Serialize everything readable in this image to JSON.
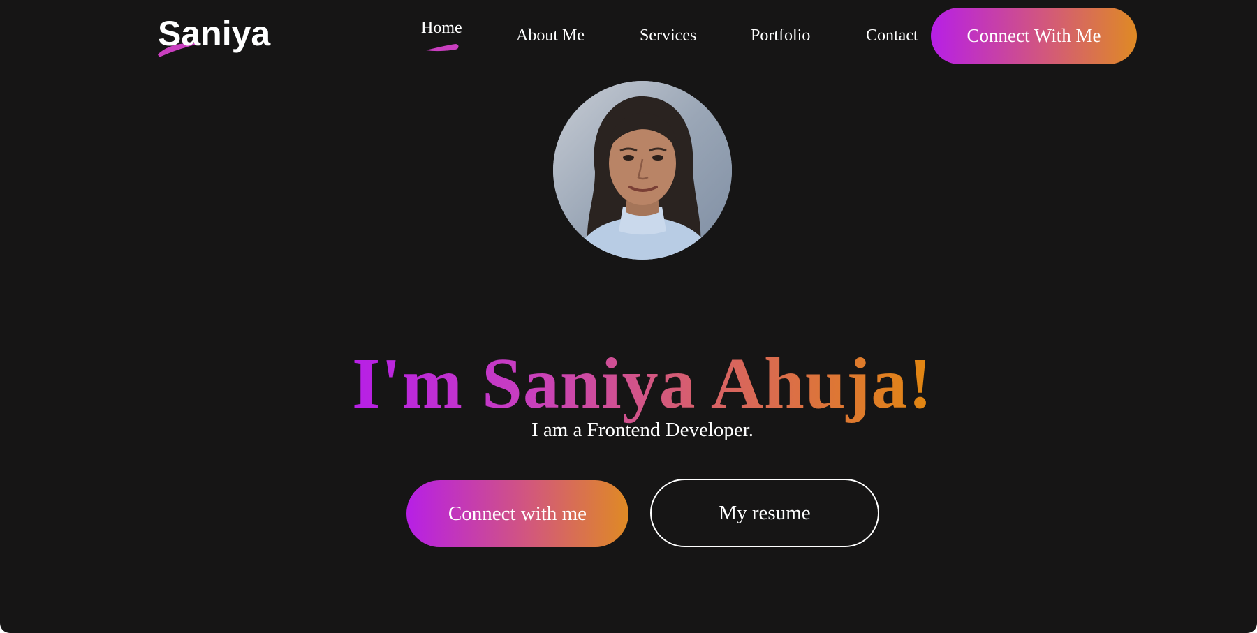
{
  "logo": {
    "text": "Saniya"
  },
  "nav": {
    "items": [
      {
        "label": "Home",
        "active": true
      },
      {
        "label": "About Me"
      },
      {
        "label": "Services"
      },
      {
        "label": "Portfolio"
      },
      {
        "label": "Contact"
      }
    ],
    "cta_label": "Connect With Me"
  },
  "hero": {
    "avatar_icon": "profile-photo",
    "title": "I'm Saniya Ahuja!",
    "subtitle": "I am a Frontend Developer.",
    "primary_button": "Connect with me",
    "secondary_button": "My resume"
  },
  "colors": {
    "background": "#161515",
    "gradient_start": "#b71fe6",
    "gradient_mid": "#d2577d",
    "gradient_end": "#df8a24",
    "text": "#ffffff"
  }
}
